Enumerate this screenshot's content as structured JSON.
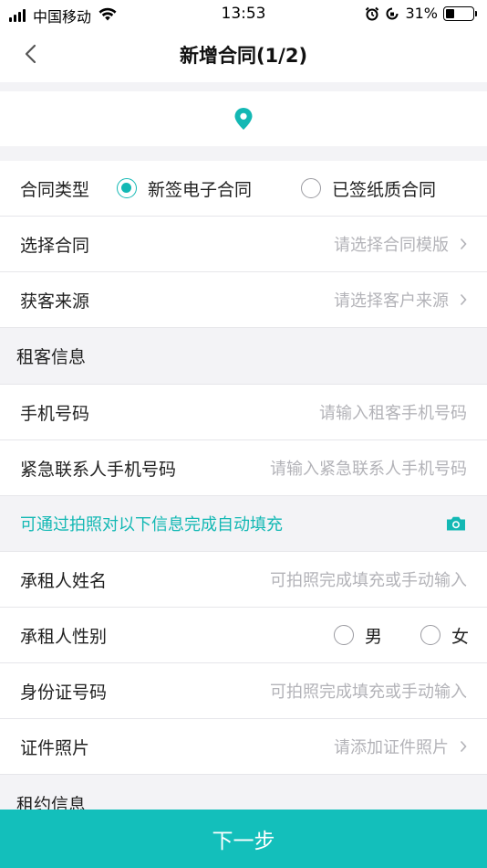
{
  "status_bar": {
    "carrier": "中国移动",
    "time": "13:53",
    "battery_percent": "31%",
    "battery_level": 0.31
  },
  "nav": {
    "title": "新增合同(1/2)",
    "back_icon": "chevron-left-icon"
  },
  "progress": {
    "icon": "location-pin-icon"
  },
  "contract": {
    "type_label": "合同类型",
    "type_options": [
      "新签电子合同",
      "已签纸质合同"
    ],
    "type_selected": 0,
    "select_label": "选择合同",
    "select_placeholder": "请选择合同模版",
    "source_label": "获客来源",
    "source_placeholder": "请选择客户来源"
  },
  "tenant_section": {
    "title": "租客信息"
  },
  "tenant": {
    "phone_label": "手机号码",
    "phone_placeholder": "请输入租客手机号码",
    "emergency_label": "紧急联系人手机号码",
    "emergency_placeholder": "请输入紧急联系人手机号码"
  },
  "auto_fill": {
    "hint": "可通过拍照对以下信息完成自动填充",
    "icon": "camera-icon"
  },
  "renter": {
    "name_label": "承租人姓名",
    "name_placeholder": "可拍照完成填充或手动输入",
    "gender_label": "承租人性别",
    "gender_options": [
      "男",
      "女"
    ],
    "id_label": "身份证号码",
    "id_placeholder": "可拍照完成填充或手动输入",
    "photo_label": "证件照片",
    "photo_placeholder": "请添加证件照片"
  },
  "lease_section": {
    "title": "租约信息"
  },
  "footer": {
    "next_label": "下一步"
  },
  "colors": {
    "accent": "#13bfbb",
    "hint": "#13b8b4",
    "placeholder": "#b3b3b8"
  }
}
